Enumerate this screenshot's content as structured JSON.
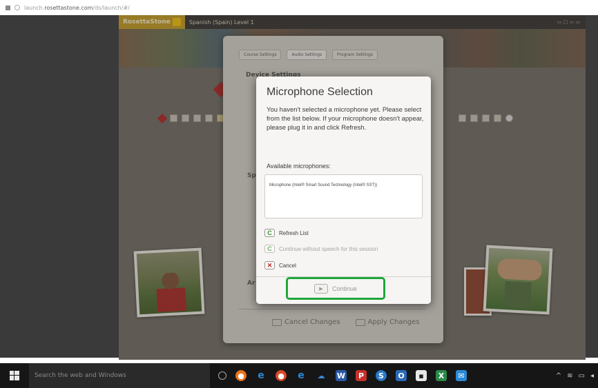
{
  "browser": {
    "url_prefix": "launch.",
    "url_host": "rosettastone.com",
    "url_path": "/ds/launch/#/"
  },
  "app": {
    "logo": "RosettaStone",
    "course": "Spanish (Spain) Level 1"
  },
  "settings_panel": {
    "tabs": [
      "Course Settings",
      "Audio Settings",
      "Program Settings"
    ],
    "section_title": "Device Settings",
    "footer": {
      "cancel_label": "Cancel Changes",
      "apply_label": "Apply Changes"
    }
  },
  "dialog": {
    "title": "Microphone Selection",
    "description": "You haven't selected a microphone yet. Please select from the list below. If your microphone doesn't appear, please plug it in and click Refresh.",
    "available_label": "Available microphones:",
    "microphones": [
      "Microphone (Intel® Smart Sound Technology (Intel® SST))"
    ],
    "options": {
      "refresh": "Refresh List",
      "no_speech": "Continue without speech for this session",
      "cancel": "Cancel"
    },
    "continue_label": "Continue"
  },
  "taskbar": {
    "search_placeholder": "Search the web and Windows"
  },
  "colors": {
    "highlight": "#1ea73c",
    "brand": "#c59a1c"
  }
}
